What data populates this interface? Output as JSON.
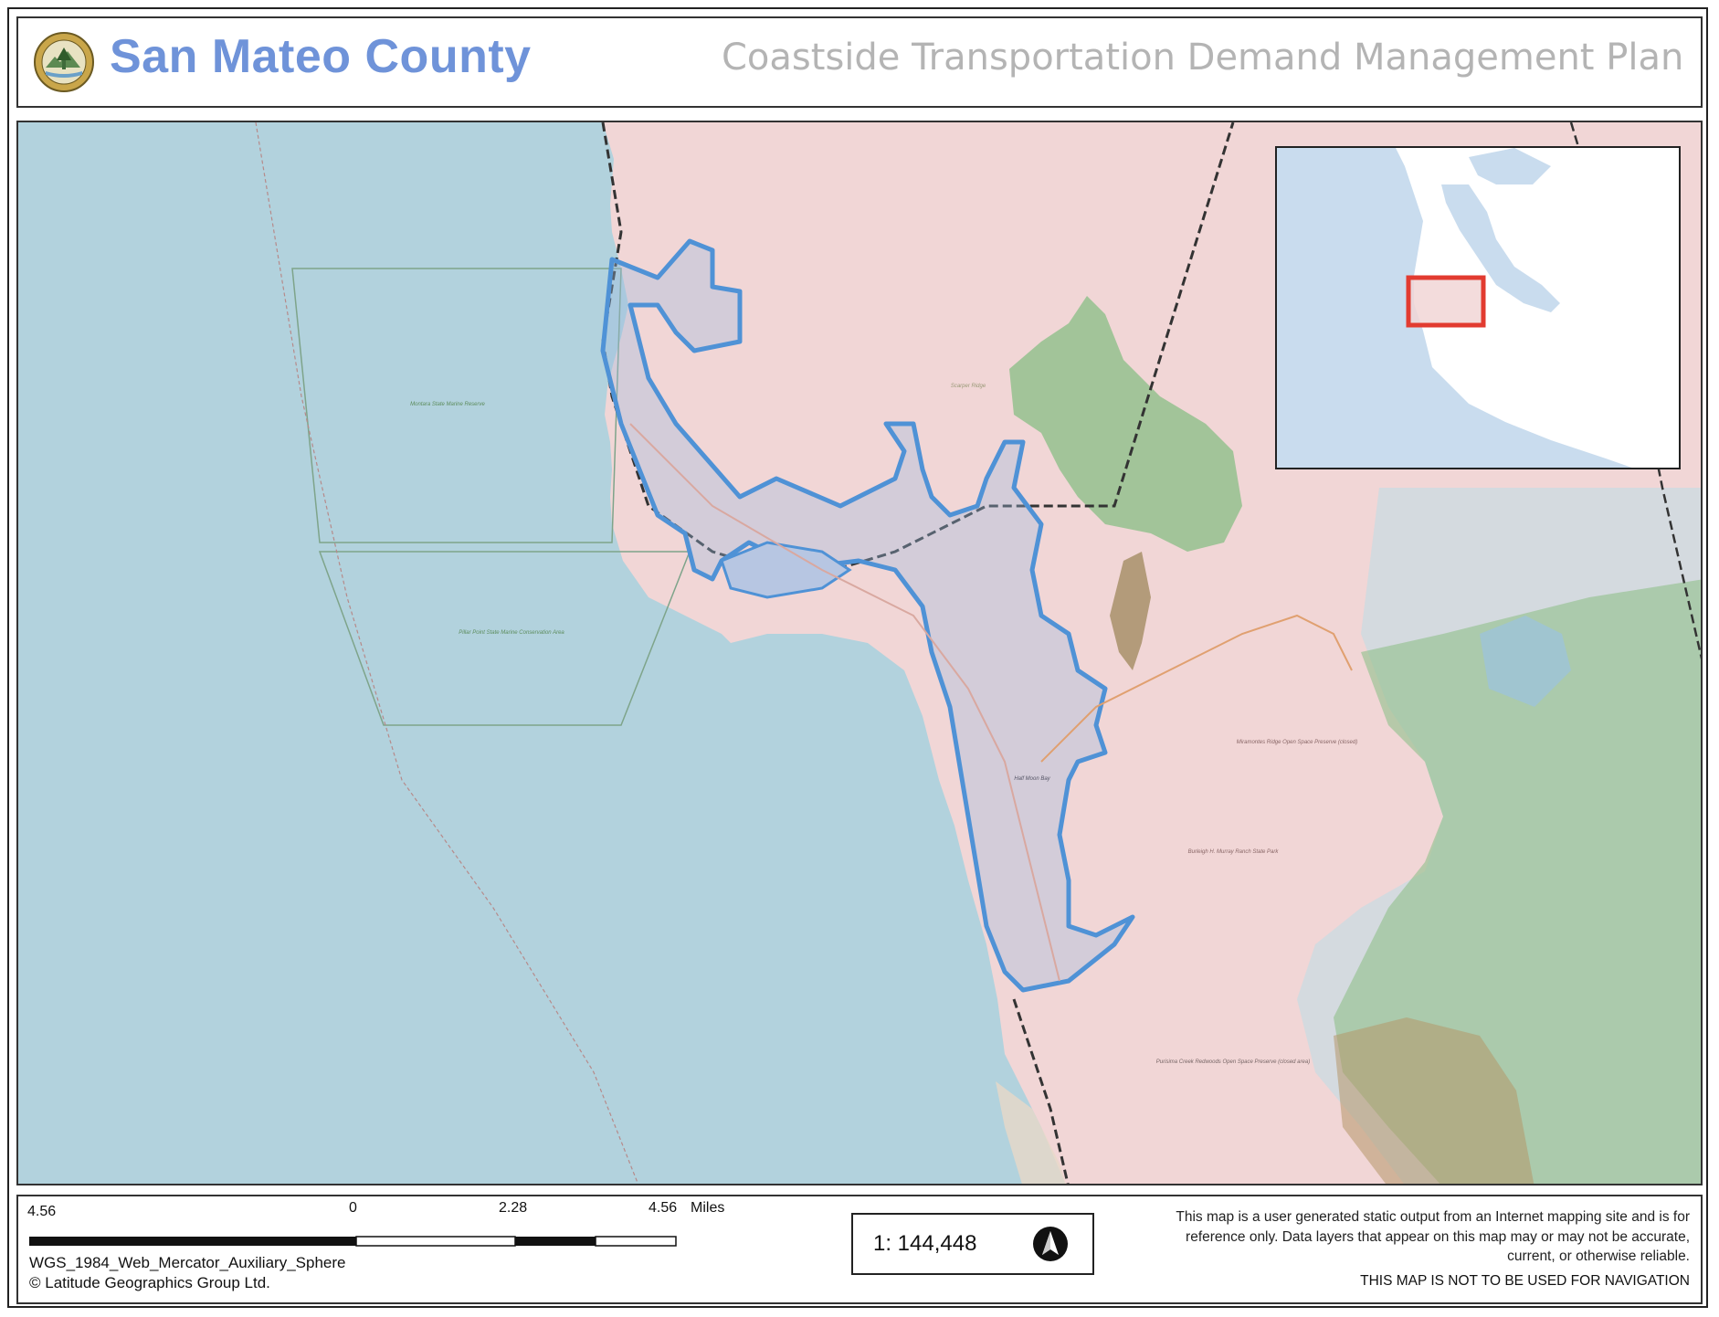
{
  "header": {
    "county_name": "San Mateo County",
    "plan_title": "Coastside Transportation Demand Management Plan",
    "seal_icon": "county-seal-icon"
  },
  "map": {
    "colors": {
      "ocean": "#b2d2dd",
      "land_overlay": "#f1d6d6",
      "park_green": "#8fbf8a",
      "study_area_outline": "#4f92d6",
      "county_boundary": "#333333",
      "inset_highlight": "#e23b30"
    },
    "labels": {
      "montara_reserve": "Montara State Marine Reserve",
      "pillar_point": "Pillar Point State Marine Conservation Area",
      "half_moon_bay": "Half Moon Bay",
      "scarper_ridge": "Scarper Ridge",
      "miramontes": "Miramontes Ridge Open Space Preserve (closed)",
      "burleigh": "Burleigh H. Murray Ranch State Park",
      "purisima": "Purisima Creek Redwoods Open Space Preserve (closed area)"
    }
  },
  "footer": {
    "scalebar": {
      "left_label": "4.56",
      "zero_label": "0",
      "mid_label": "2.28",
      "right_label": "4.56",
      "unit": "Miles"
    },
    "projection": "WGS_1984_Web_Mercator_Auxiliary_Sphere",
    "copyright": "© Latitude Geographics Group Ltd.",
    "scale_ratio": "1: 144,448",
    "north_icon": "north-arrow-icon",
    "disclaimer": "This map is a user generated static output from an Internet mapping site and is for reference only. Data layers that appear on this map may or may not be accurate, current, or otherwise reliable.",
    "navigation_warning": "THIS MAP IS NOT TO BE USED FOR NAVIGATION"
  }
}
